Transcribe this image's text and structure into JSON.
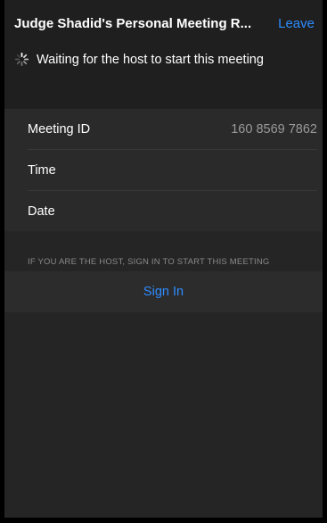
{
  "header": {
    "title": "Judge Shadid's Personal Meeting R...",
    "leave_label": "Leave",
    "status_text": "Waiting for the host to start this meeting",
    "status_icon": "loading-spinner-icon"
  },
  "meeting_info": {
    "rows": [
      {
        "label": "Meeting ID",
        "value": "160 8569 7862"
      },
      {
        "label": "Time",
        "value": ""
      },
      {
        "label": "Date",
        "value": ""
      }
    ]
  },
  "host_note": "IF YOU ARE THE HOST, SIGN IN TO START THIS MEETING",
  "sign_in_label": "Sign In",
  "colors": {
    "accent": "#2d8cff",
    "background": "#252525",
    "header_background": "#1f1f1f"
  }
}
